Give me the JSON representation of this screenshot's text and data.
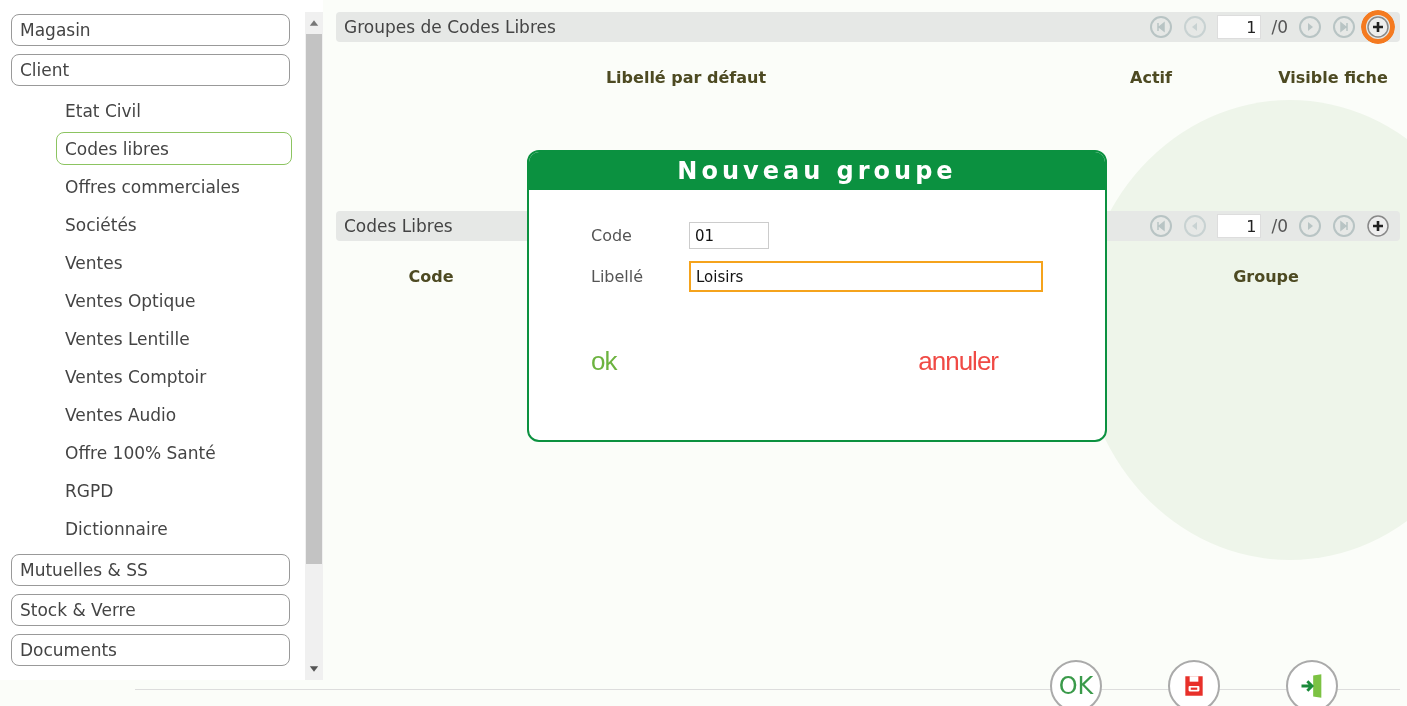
{
  "sidebar": {
    "sections": [
      {
        "label": "Magasin"
      },
      {
        "label": "Client",
        "children": [
          {
            "label": "Etat Civil",
            "selected": false
          },
          {
            "label": "Codes libres",
            "selected": true
          },
          {
            "label": "Offres commerciales",
            "selected": false
          },
          {
            "label": "Sociétés",
            "selected": false
          },
          {
            "label": "Ventes",
            "selected": false
          },
          {
            "label": "Ventes Optique",
            "selected": false
          },
          {
            "label": "Ventes Lentille",
            "selected": false
          },
          {
            "label": "Ventes Comptoir",
            "selected": false
          },
          {
            "label": "Ventes Audio",
            "selected": false
          },
          {
            "label": "Offre 100% Santé",
            "selected": false
          },
          {
            "label": "RGPD",
            "selected": false
          },
          {
            "label": "Dictionnaire",
            "selected": false
          }
        ]
      },
      {
        "label": "Mutuelles & SS"
      },
      {
        "label": "Stock & Verre"
      },
      {
        "label": "Documents"
      }
    ]
  },
  "panels": [
    {
      "title": "Groupes de Codes Libres",
      "page": "1",
      "total": "/0",
      "add_highlighted": true,
      "columns": [
        "",
        "Libellé par défaut",
        "Actif",
        "Visible fiche"
      ]
    },
    {
      "title": "Codes Libres",
      "page": "1",
      "total": "/0",
      "add_highlighted": false,
      "columns": [
        "Code",
        "",
        "Groupe",
        ""
      ]
    }
  ],
  "dialog": {
    "title": "Nouveau groupe",
    "fields": [
      {
        "kind": "short",
        "label": "Code",
        "value": "01",
        "focused": false
      },
      {
        "kind": "wide",
        "label": "Libellé",
        "value": "Loisirs",
        "focused": true
      }
    ],
    "ok": "ok",
    "cancel": "annuler"
  },
  "footer": {
    "ok": "OK"
  }
}
